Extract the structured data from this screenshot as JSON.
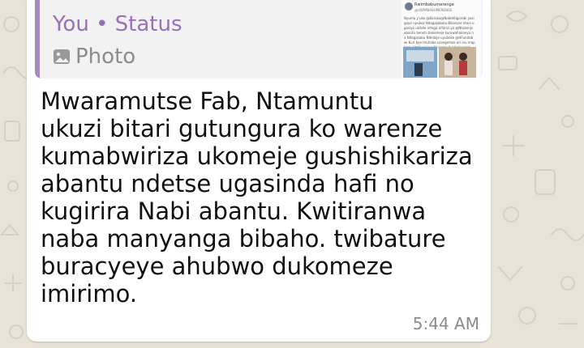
{
  "quoted": {
    "sender": "You • Status",
    "kind_label": "Photo",
    "kind_icon": "photo-icon",
    "thumbnail": {
      "author": "Rwimbabumerenge",
      "handle": "@UWIMBABUMERENGE",
      "text": "Nyuma y'uko @Baraka@NobleKigorobi yosigaye uyuboz Ndagajabaka Bikorose ntaio ugasiya ukiblie intega nifanzi ya @Ntubenjs abantu benshi bakomeje kumwahakanya na Ndagasabu Ndelaije uyuboke @HFundabwi Kuri bye muhabe ussegemze ari inu mapkiga. Umbi ari inu binsemu byi bukyerela."
    },
    "accent_color": "#a58abf",
    "sender_color": "#9a6fb8"
  },
  "message": {
    "text": "Mwaramutse Fab, Ntamuntu\nukuzi bitari gutungura ko warenze\nkumabwiriza ukomeje gushishikariza\nabantu ndetse ugasinda hafi no\nkugirira Nabi abantu. Kwitiranwa\nnaba manyanga bibaho. twibature\nburacyeye ahubwo dukomeze\nimirimo.",
    "time": "5:44 AM"
  },
  "colors": {
    "wallpaper": "#e9e2d6",
    "bubble": "#ffffff",
    "quote_bg": "#f2f2f2"
  }
}
